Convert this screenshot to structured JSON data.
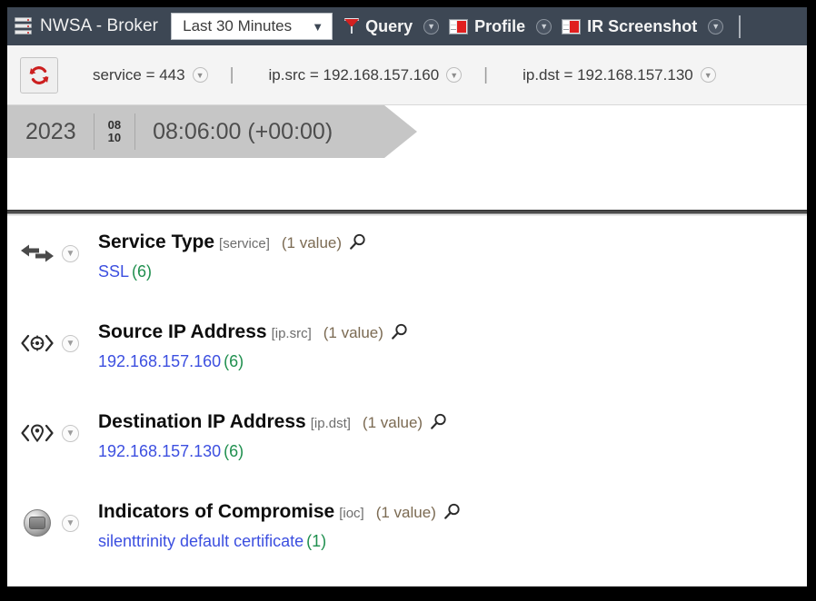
{
  "app": {
    "title": "NWSA - Broker",
    "server_icon": "server-icon"
  },
  "topbar": {
    "time_range": {
      "value": "Last 30 Minutes",
      "chevron": "chevron-down-icon"
    },
    "nav_items": [
      {
        "label": "Query",
        "icon": "funnel-icon",
        "caret": "chevron-down-icon"
      },
      {
        "label": "Profile",
        "icon": "panel-layout-icon",
        "caret": "chevron-down-icon"
      },
      {
        "label": "IR Screenshot",
        "icon": "panel-layout-icon",
        "caret": "chevron-down-icon"
      }
    ]
  },
  "filterbar": {
    "refresh_icon": "refresh-icon",
    "conditions": [
      {
        "text": "service = 443",
        "caret": "chevron-down-icon"
      },
      {
        "text": "ip.src = 192.168.157.160",
        "caret": "chevron-down-icon"
      },
      {
        "text": "ip.dst = 192.168.157.130",
        "caret": "chevron-down-icon"
      }
    ],
    "separator": "|"
  },
  "timeline": {
    "year": "2023",
    "month": "08",
    "day": "10",
    "time": "08:06:00 (+00:00)"
  },
  "meta_rows": [
    {
      "icon": "bidirectional-arrows-icon",
      "caret": "chevron-down-icon",
      "title": "Service Type",
      "key": "[service]",
      "count_label": "(1 value)",
      "search_icon": "magnifier-icon",
      "value": "SSL",
      "value_count": "(6)"
    },
    {
      "icon": "source-ip-icon",
      "caret": "chevron-down-icon",
      "title": "Source IP Address",
      "key": "[ip.src]",
      "count_label": "(1 value)",
      "search_icon": "magnifier-icon",
      "value": "192.168.157.160",
      "value_count": "(6)"
    },
    {
      "icon": "destination-ip-icon",
      "caret": "chevron-down-icon",
      "title": "Destination IP Address",
      "key": "[ip.dst]",
      "count_label": "(1 value)",
      "search_icon": "magnifier-icon",
      "value": "192.168.157.130",
      "value_count": "(6)"
    },
    {
      "icon": "ioc-badge-icon",
      "caret": "chevron-down-icon",
      "title": "Indicators of Compromise",
      "key": "[ioc]",
      "count_label": "(1 value)",
      "search_icon": "magnifier-icon",
      "value": "silenttrinity default certificate",
      "value_count": "(1)"
    }
  ],
  "colors": {
    "topbar_bg": "#3d4754",
    "filterbar_bg": "#f4f4f4",
    "timeline_bg": "#c6c6c6",
    "link": "#3c4fe0",
    "count_green": "#1f8f4e",
    "accent_red": "#d32020"
  }
}
